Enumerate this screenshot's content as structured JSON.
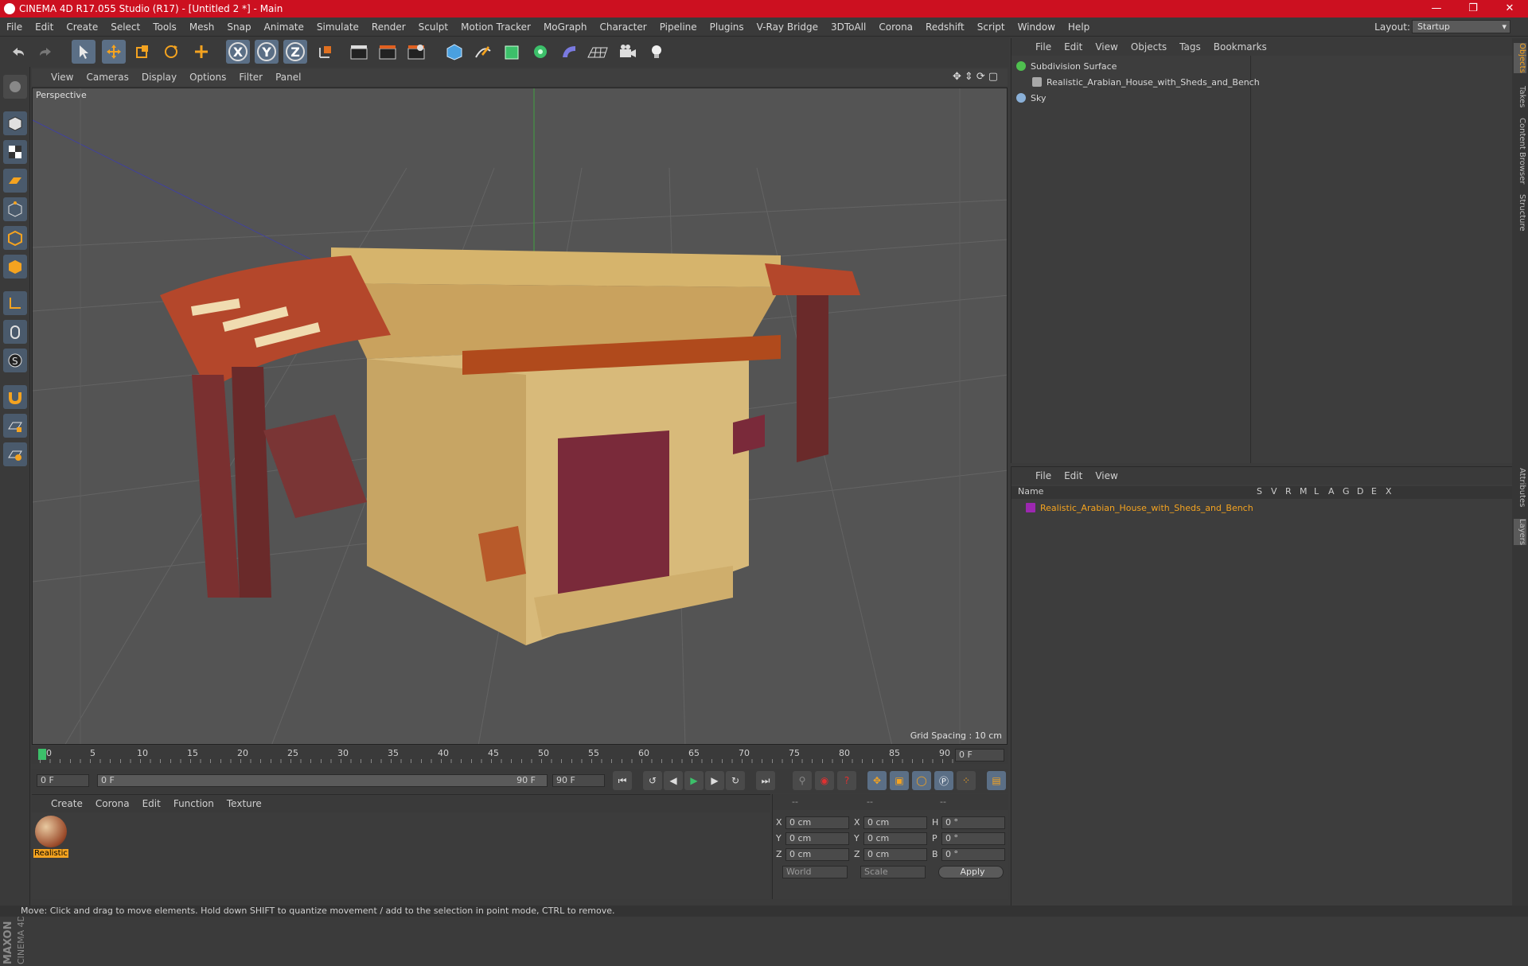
{
  "window": {
    "title": "CINEMA 4D R17.055 Studio (R17) - [Untitled 2 *] - Main",
    "controls": [
      "—",
      "❐",
      "✕"
    ]
  },
  "menu": [
    "File",
    "Edit",
    "Create",
    "Select",
    "Tools",
    "Mesh",
    "Snap",
    "Animate",
    "Simulate",
    "Render",
    "Sculpt",
    "Motion Tracker",
    "MoGraph",
    "Character",
    "Pipeline",
    "Plugins",
    "V-Ray Bridge",
    "3DToAll",
    "Corona",
    "Redshift",
    "Script",
    "Window",
    "Help"
  ],
  "layout": {
    "label": "Layout:",
    "value": "Startup"
  },
  "toolbar": {
    "axis_x": "X",
    "axis_y": "Y",
    "axis_z": "Z"
  },
  "viewport": {
    "menu": [
      "View",
      "Cameras",
      "Display",
      "Options",
      "Filter",
      "Panel"
    ],
    "label": "Perspective",
    "grid_spacing": "Grid Spacing : 10 cm"
  },
  "timeline": {
    "ticks": [
      "0",
      "5",
      "10",
      "15",
      "20",
      "25",
      "30",
      "35",
      "40",
      "45",
      "50",
      "55",
      "60",
      "65",
      "70",
      "75",
      "80",
      "85",
      "90"
    ],
    "current_frame": "0 F"
  },
  "transport": {
    "start": "0 F",
    "range_start": "0 F",
    "range_end": "90 F",
    "end": "90 F"
  },
  "materials": {
    "menu": [
      "Create",
      "Corona",
      "Edit",
      "Function",
      "Texture"
    ],
    "items": [
      {
        "label": "Realistic"
      }
    ]
  },
  "coords": {
    "headers": [
      "--",
      "--",
      "--"
    ],
    "rows": [
      {
        "a": "X",
        "av": "0 cm",
        "b": "X",
        "bv": "0 cm",
        "c": "H",
        "cv": "0 °"
      },
      {
        "a": "Y",
        "av": "0 cm",
        "b": "Y",
        "bv": "0 cm",
        "c": "P",
        "cv": "0 °"
      },
      {
        "a": "Z",
        "av": "0 cm",
        "b": "Z",
        "bv": "0 cm",
        "c": "B",
        "cv": "0 °"
      }
    ],
    "mode1": "World",
    "mode2": "Scale",
    "apply": "Apply"
  },
  "objects": {
    "menu": [
      "File",
      "Edit",
      "View",
      "Objects",
      "Tags",
      "Bookmarks"
    ],
    "items": [
      {
        "name": "Subdivision Surface",
        "color": "#4fc04f"
      },
      {
        "name": "Realistic_Arabian_House_with_Sheds_and_Bench",
        "color": "#a8a8a8"
      },
      {
        "name": "Sky",
        "color": "#8ab0d8"
      }
    ]
  },
  "layers": {
    "menu": [
      "File",
      "Edit",
      "View"
    ],
    "columns": [
      "Name",
      "S",
      "V",
      "R",
      "M",
      "L",
      "A",
      "G",
      "D",
      "E",
      "X"
    ],
    "items": [
      {
        "name": "Realistic_Arabian_House_with_Sheds_and_Bench",
        "color": "#9c27b0"
      }
    ]
  },
  "right_tabs": [
    "Objects",
    "Takes",
    "Content Browser",
    "Structure",
    "Attributes",
    "Layers"
  ],
  "status": "Move: Click and drag to move elements. Hold down SHIFT to quantize movement / add to the selection in point mode, CTRL to remove.",
  "branding": {
    "maxon": "MAXON",
    "cinema": "CINEMA 4D"
  }
}
